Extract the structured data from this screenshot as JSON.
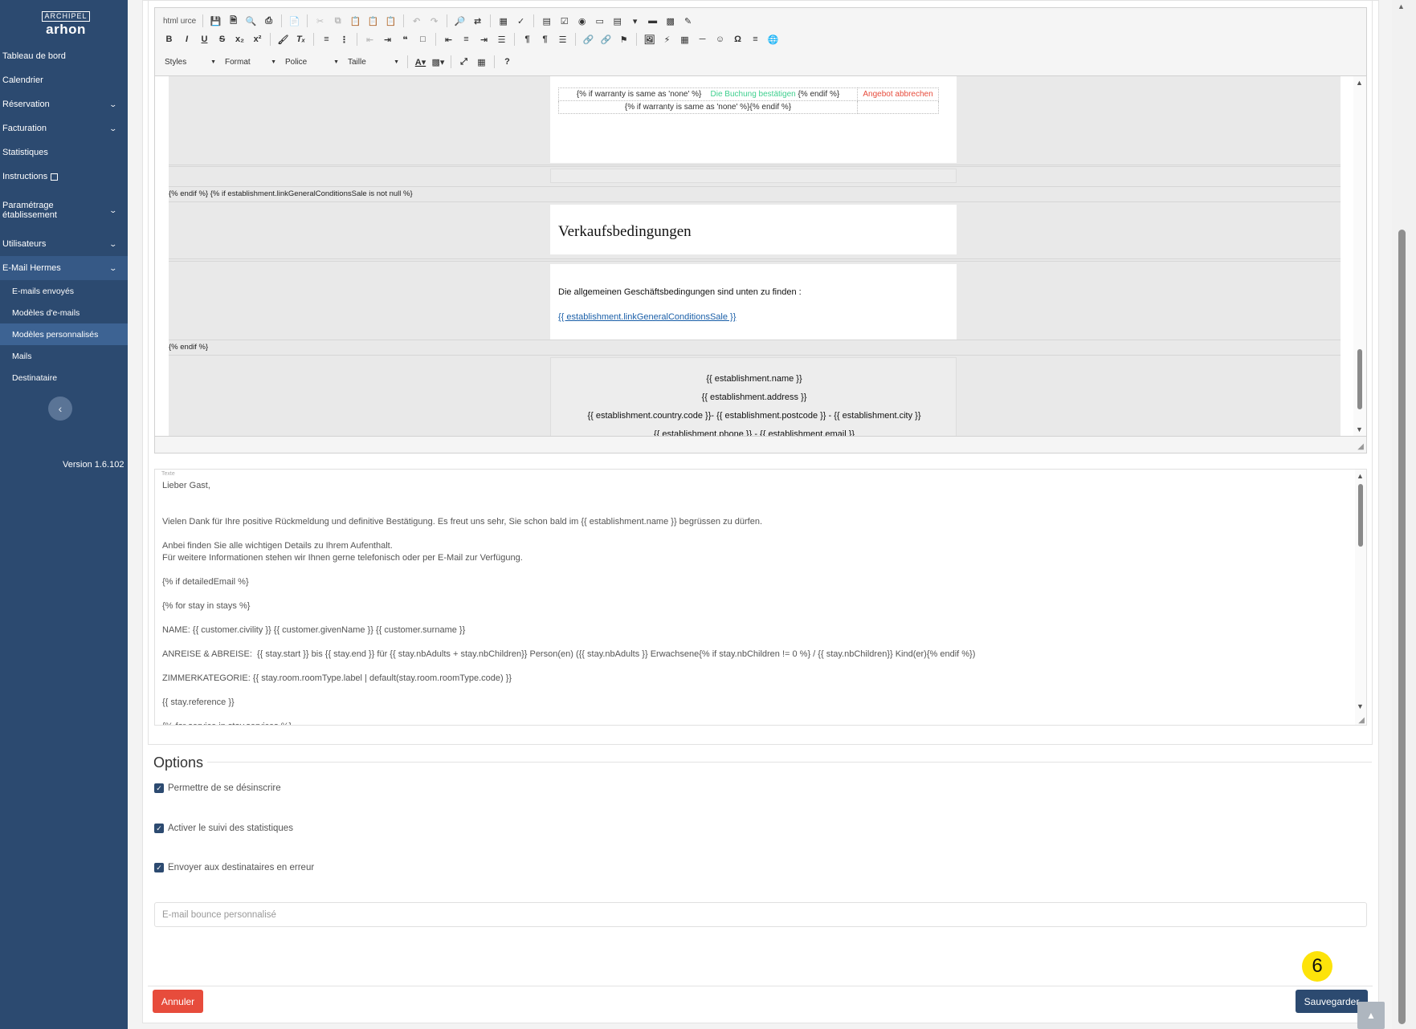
{
  "app": {
    "logo_mark": "ARCHIPEL",
    "logo_text": "arhon",
    "version": "Version 1.6.102"
  },
  "sidebar": {
    "items": [
      {
        "label": "Tableau de bord",
        "chevron": false
      },
      {
        "label": "Calendrier",
        "chevron": false
      },
      {
        "label": "Réservation",
        "chevron": true
      },
      {
        "label": "Facturation",
        "chevron": true
      },
      {
        "label": "Statistiques",
        "chevron": false
      },
      {
        "label": "Instructions",
        "chevron": false,
        "external": true
      }
    ],
    "items2": [
      {
        "label": "Paramétrage établissement",
        "chevron": true
      }
    ],
    "items3": [
      {
        "label": "Utilisateurs",
        "chevron": true
      },
      {
        "label": "E-Mail Hermes",
        "chevron": true
      }
    ],
    "sub_items": [
      {
        "label": "E-mails envoyés"
      },
      {
        "label": "Modèles d'e-mails"
      },
      {
        "label": "Modèles personnalisés"
      },
      {
        "label": "Mails"
      },
      {
        "label": "Destinataire"
      }
    ],
    "collapse_icon": "chevron-left-icon"
  },
  "toolbar": {
    "source_label": "html",
    "source_sub": "urce",
    "styles_label": "Styles",
    "format_label": "Format",
    "police_label": "Police",
    "taille_label": "Taille"
  },
  "wysiwyg": {
    "cond_left": "{% if warranty is same as 'none' %}",
    "confirm_link": "Die Buchung bestätigen",
    "cond_endif": "{% endif %}",
    "cancel_link": "Angebot abbrechen",
    "cond_row2": "{% if warranty is same as 'none' %}{% endif %}",
    "tpl_line1": "{% endif %} {% if establishment.linkGeneralConditionsSale is not null %}",
    "heading": "Verkaufsbedingungen",
    "para": "Die allgemeinen Geschäftsbedingungen sind unten zu finden :",
    "link": "{{ establishment.linkGeneralConditionsSale }}",
    "tpl_line2": "{% endif %}",
    "footer": [
      "{{ establishment.name }}",
      "{{ establishment.address }}",
      "{{ establishment.country.code }}- {{ establishment.postcode }} - {{ establishment.city }}",
      "{{ establishment.phone }} - {{ establishment.email }}"
    ]
  },
  "texte": {
    "label": "Texte",
    "content": "Lieber Gast,\n\n\nVielen Dank für Ihre positive Rückmeldung und definitive Bestätigung. Es freut uns sehr, Sie schon bald im {{ establishment.name }} begrüssen zu dürfen.\n\nAnbei finden Sie alle wichtigen Details zu Ihrem Aufenthalt.\nFür weitere Informationen stehen wir Ihnen gerne telefonisch oder per E-Mail zur Verfügung.\n\n{% if detailedEmail %}\n\n{% for stay in stays %}\n\nNAME: {{ customer.civility }} {{ customer.givenName }} {{ customer.surname }}\n\nANREISE & ABREISE:  {{ stay.start }} bis {{ stay.end }} für {{ stay.nbAdults + stay.nbChildren}} Person(en) ({{ stay.nbAdults }} Erwachsene{% if stay.nbChildren != 0 %} / {{ stay.nbChildren}} Kind(er){% endif %})\n\nZIMMERKATEGORIE: {{ stay.room.roomType.label | default(stay.room.roomType.code) }}\n\n{{ stay.reference }}\n\n{% for service in stay.services %}"
  },
  "options": {
    "legend": "Options",
    "unsubscribe": "Permettre de se désinscrire",
    "stats": "Activer le suivi des statistiques",
    "errors": "Envoyer aux destinataires en erreur",
    "bounce_placeholder": "E-mail bounce personnalisé"
  },
  "actions": {
    "cancel": "Annuler",
    "save": "Sauvegarder",
    "step_badge": "6"
  },
  "colors": {
    "sidebar": "#2c4a70",
    "cancel": "#e74c3c",
    "save": "#2c4a70",
    "badge": "#fde30a",
    "green_link": "#3ecf8e"
  }
}
